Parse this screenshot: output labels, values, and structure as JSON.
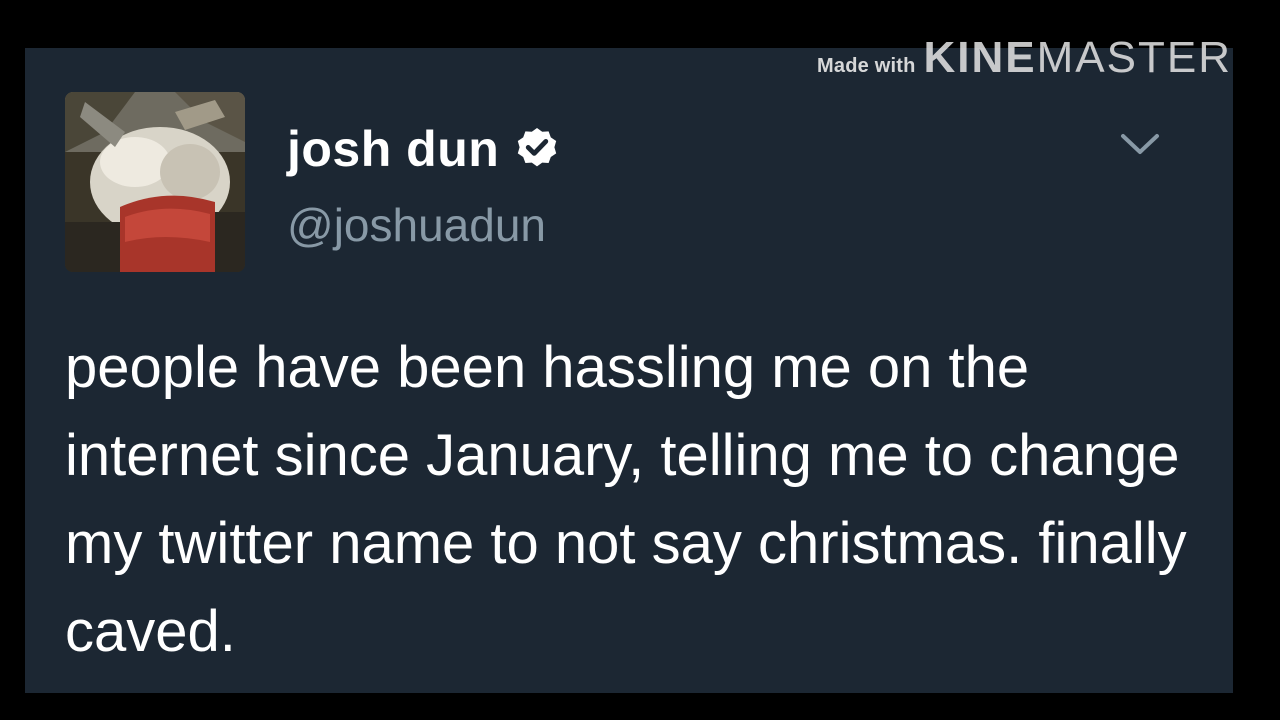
{
  "watermark": {
    "made_with": "Made with",
    "brand_bold": "KINE",
    "brand_light": "MASTER"
  },
  "tweet": {
    "user_name": "josh dun",
    "handle": "@joshuadun",
    "verified": true,
    "text": "people have been hassling me on the internet since January, telling me to change my twitter name to not say christmas. finally caved."
  },
  "icons": {
    "verified": "verified-badge-icon",
    "menu": "chevron-down-icon"
  },
  "colors": {
    "background": "#1c2733",
    "outer": "#000000",
    "text": "#ffffff",
    "handle": "#8899a6"
  }
}
